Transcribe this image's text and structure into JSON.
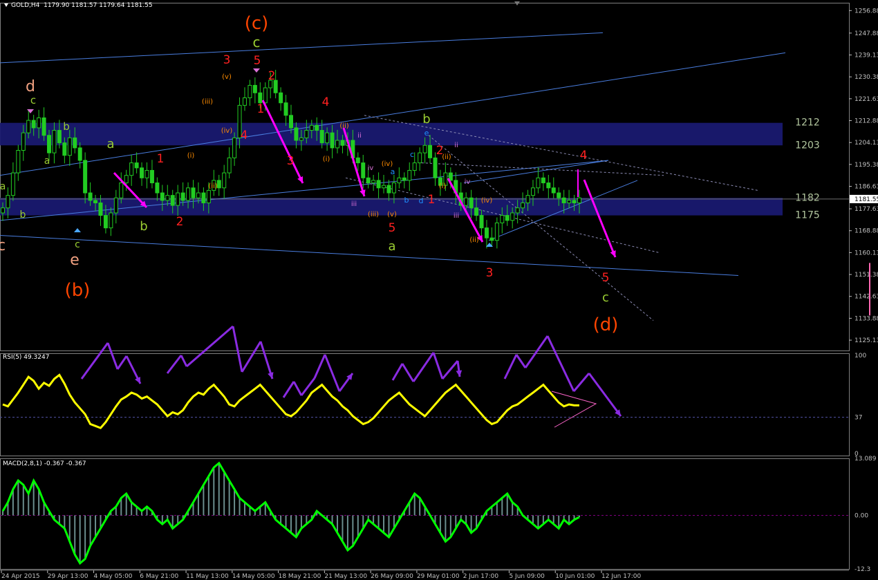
{
  "header": {
    "symbol_label": "GOLD,H4",
    "ohlc": "1179.90 1181.57 1179.64 1181.55"
  },
  "rsi_label": "RSI(5) 49.3247",
  "macd_label": "MACD(2,8,1) -0.367 -0.367",
  "colors": {
    "background": "#000000",
    "zone": "#191970",
    "price": "#22cc22",
    "rsi": "#ffff00",
    "macd": "#00ff00",
    "macd_hist": "#6b8e8e",
    "trendline": "#4a7ee0",
    "forecast_arrow": "#ff00ff",
    "rsi_arrow": "#8a2be2",
    "axis": "#c0c0c0"
  },
  "chart_data": [
    {
      "type": "candlestick",
      "title": "GOLD,H4",
      "y_ticks": [
        "1256.88",
        "1247.88",
        "1239.13",
        "1230.38",
        "1221.63",
        "1212.88",
        "1204.13",
        "1195.38",
        "1186.63",
        "1177.63",
        "1168.88",
        "1160.13",
        "1151.38",
        "1142.63",
        "1133.88",
        "1125.13"
      ],
      "x_ticks": [
        "24 Apr 2015",
        "29 Apr 13:00",
        "4 May 05:00",
        "6 May 21:00",
        "11 May 13:00",
        "14 May 05:00",
        "18 May 21:00",
        "21 May 13:00",
        "26 May 09:00",
        "29 May 01:00",
        "2 Jun 17:00",
        "5 Jun 09:00",
        "10 Jun 01:00",
        "12 Jun 17:00"
      ],
      "ylim": [
        1121,
        1260
      ],
      "current_price": "1181.55",
      "zones": [
        {
          "from": 1203,
          "to": 1212,
          "labels": [
            "1212",
            "1203"
          ]
        },
        {
          "from": 1175,
          "to": 1182,
          "labels": [
            "1182",
            "1175"
          ]
        }
      ],
      "closes": [
        1178,
        1183,
        1192,
        1201,
        1208,
        1213,
        1210,
        1214,
        1207,
        1200,
        1209,
        1204,
        1199,
        1206,
        1202,
        1197,
        1184,
        1181,
        1180,
        1175,
        1170,
        1176,
        1182,
        1188,
        1191,
        1196,
        1194,
        1190,
        1193,
        1188,
        1184,
        1181,
        1183,
        1179,
        1184,
        1181,
        1186,
        1182,
        1184,
        1180,
        1185,
        1189,
        1186,
        1192,
        1198,
        1206,
        1219,
        1222,
        1227,
        1224,
        1220,
        1226,
        1229,
        1224,
        1220,
        1215,
        1210,
        1205,
        1206,
        1209,
        1211,
        1209,
        1204,
        1208,
        1202,
        1205,
        1203,
        1205,
        1198,
        1196,
        1190,
        1188,
        1189,
        1186,
        1187,
        1184,
        1188,
        1190,
        1189,
        1193,
        1196,
        1200,
        1203,
        1198,
        1190,
        1187,
        1192,
        1189,
        1184,
        1179,
        1182,
        1178,
        1175,
        1170,
        1166,
        1165,
        1172,
        1175,
        1173,
        1176,
        1178,
        1180,
        1183,
        1186,
        1190,
        1188,
        1186,
        1184,
        1182,
        1180,
        1181,
        1180,
        1182
      ],
      "wave_labels": [
        {
          "text": "(c)",
          "x": 1215,
          "kind": "degree"
        },
        {
          "text": "(b)",
          "x": 1150,
          "kind": "degree"
        },
        {
          "text": "(d)",
          "x": 1134,
          "kind": "degree"
        },
        {
          "text": "c",
          "x": 1252,
          "kind": "minor"
        },
        {
          "text": "d",
          "x": 1221,
          "kind": "intermediate"
        },
        {
          "text": "e",
          "x": 1179,
          "kind": "intermediate"
        }
      ],
      "forecast": [
        "4",
        "5",
        "c",
        "(d)"
      ],
      "annotations_red": [
        "3",
        "5",
        "2",
        "1",
        "4",
        "4",
        "3",
        "1",
        "2",
        "2",
        "5",
        "1",
        "2",
        "3",
        "4",
        "5"
      ],
      "annotations_green": [
        "c",
        "b",
        "a",
        "a",
        "b",
        "b",
        "a",
        "b",
        "c",
        "a",
        "c"
      ],
      "annotations_orange": [
        "(v)",
        "(iii)",
        "(iv)",
        "(i)",
        "(ii)",
        "(ii)",
        "(i)",
        "(iv)",
        "(iii)",
        "(v)",
        "(iv)",
        "(ii)",
        "(ii)",
        "(i)"
      ],
      "annotations_blue": [
        "e",
        "c",
        "a",
        "b",
        "d"
      ],
      "annotations_magenta": [
        "iv",
        "ii",
        "iii",
        "iii",
        "ii",
        "iv",
        "i"
      ]
    },
    {
      "type": "line",
      "title": "RSI(5) 49.3247",
      "ylim": [
        0,
        100
      ],
      "y_ticks": [
        "100",
        "37",
        "0"
      ],
      "level": 37,
      "values": [
        50,
        48,
        55,
        62,
        70,
        78,
        74,
        66,
        72,
        69,
        76,
        80,
        71,
        60,
        52,
        46,
        40,
        30,
        28,
        26,
        32,
        40,
        48,
        55,
        58,
        62,
        60,
        56,
        58,
        54,
        50,
        44,
        38,
        42,
        40,
        44,
        52,
        58,
        62,
        60,
        66,
        70,
        64,
        58,
        50,
        48,
        54,
        58,
        62,
        66,
        70,
        64,
        58,
        52,
        46,
        40,
        38,
        42,
        48,
        54,
        62,
        66,
        70,
        64,
        58,
        54,
        48,
        44,
        38,
        34,
        30,
        32,
        36,
        42,
        48,
        54,
        58,
        62,
        56,
        50,
        46,
        42,
        38,
        44,
        50,
        56,
        62,
        66,
        70,
        64,
        58,
        52,
        46,
        40,
        34,
        30,
        32,
        38,
        44,
        48,
        50,
        54,
        58,
        62,
        66,
        70,
        64,
        58,
        52,
        48,
        50,
        49,
        49
      ]
    },
    {
      "type": "area",
      "title": "MACD(2,8,1) -0.367 -0.367",
      "ylim": [
        -12.3,
        13.089
      ],
      "y_ticks": [
        "13.089",
        "0.00",
        "-12.3"
      ],
      "values": [
        1,
        3,
        6,
        8,
        7,
        5,
        8,
        6,
        3,
        1,
        -1,
        -2,
        -3,
        -6,
        -9,
        -11,
        -10,
        -7,
        -5,
        -3,
        -1,
        1,
        2,
        4,
        5,
        3,
        2,
        1,
        2,
        1,
        -1,
        -2,
        -1,
        -3,
        -2,
        -1,
        1,
        3,
        5,
        7,
        9,
        11,
        12,
        10,
        8,
        6,
        4,
        3,
        2,
        1,
        2,
        3,
        1,
        -1,
        -2,
        -3,
        -4,
        -5,
        -3,
        -2,
        -1,
        1,
        0,
        -1,
        -2,
        -4,
        -6,
        -8,
        -7,
        -5,
        -3,
        -1,
        -2,
        -3,
        -4,
        -5,
        -3,
        -1,
        1,
        3,
        5,
        4,
        2,
        0,
        -2,
        -4,
        -6,
        -5,
        -3,
        -1,
        -2,
        -4,
        -3,
        -1,
        1,
        2,
        3,
        4,
        5,
        3,
        2,
        0,
        -1,
        -2,
        -3,
        -2,
        -1,
        -2,
        -3,
        -1,
        -2,
        -1,
        -0.4
      ]
    }
  ]
}
